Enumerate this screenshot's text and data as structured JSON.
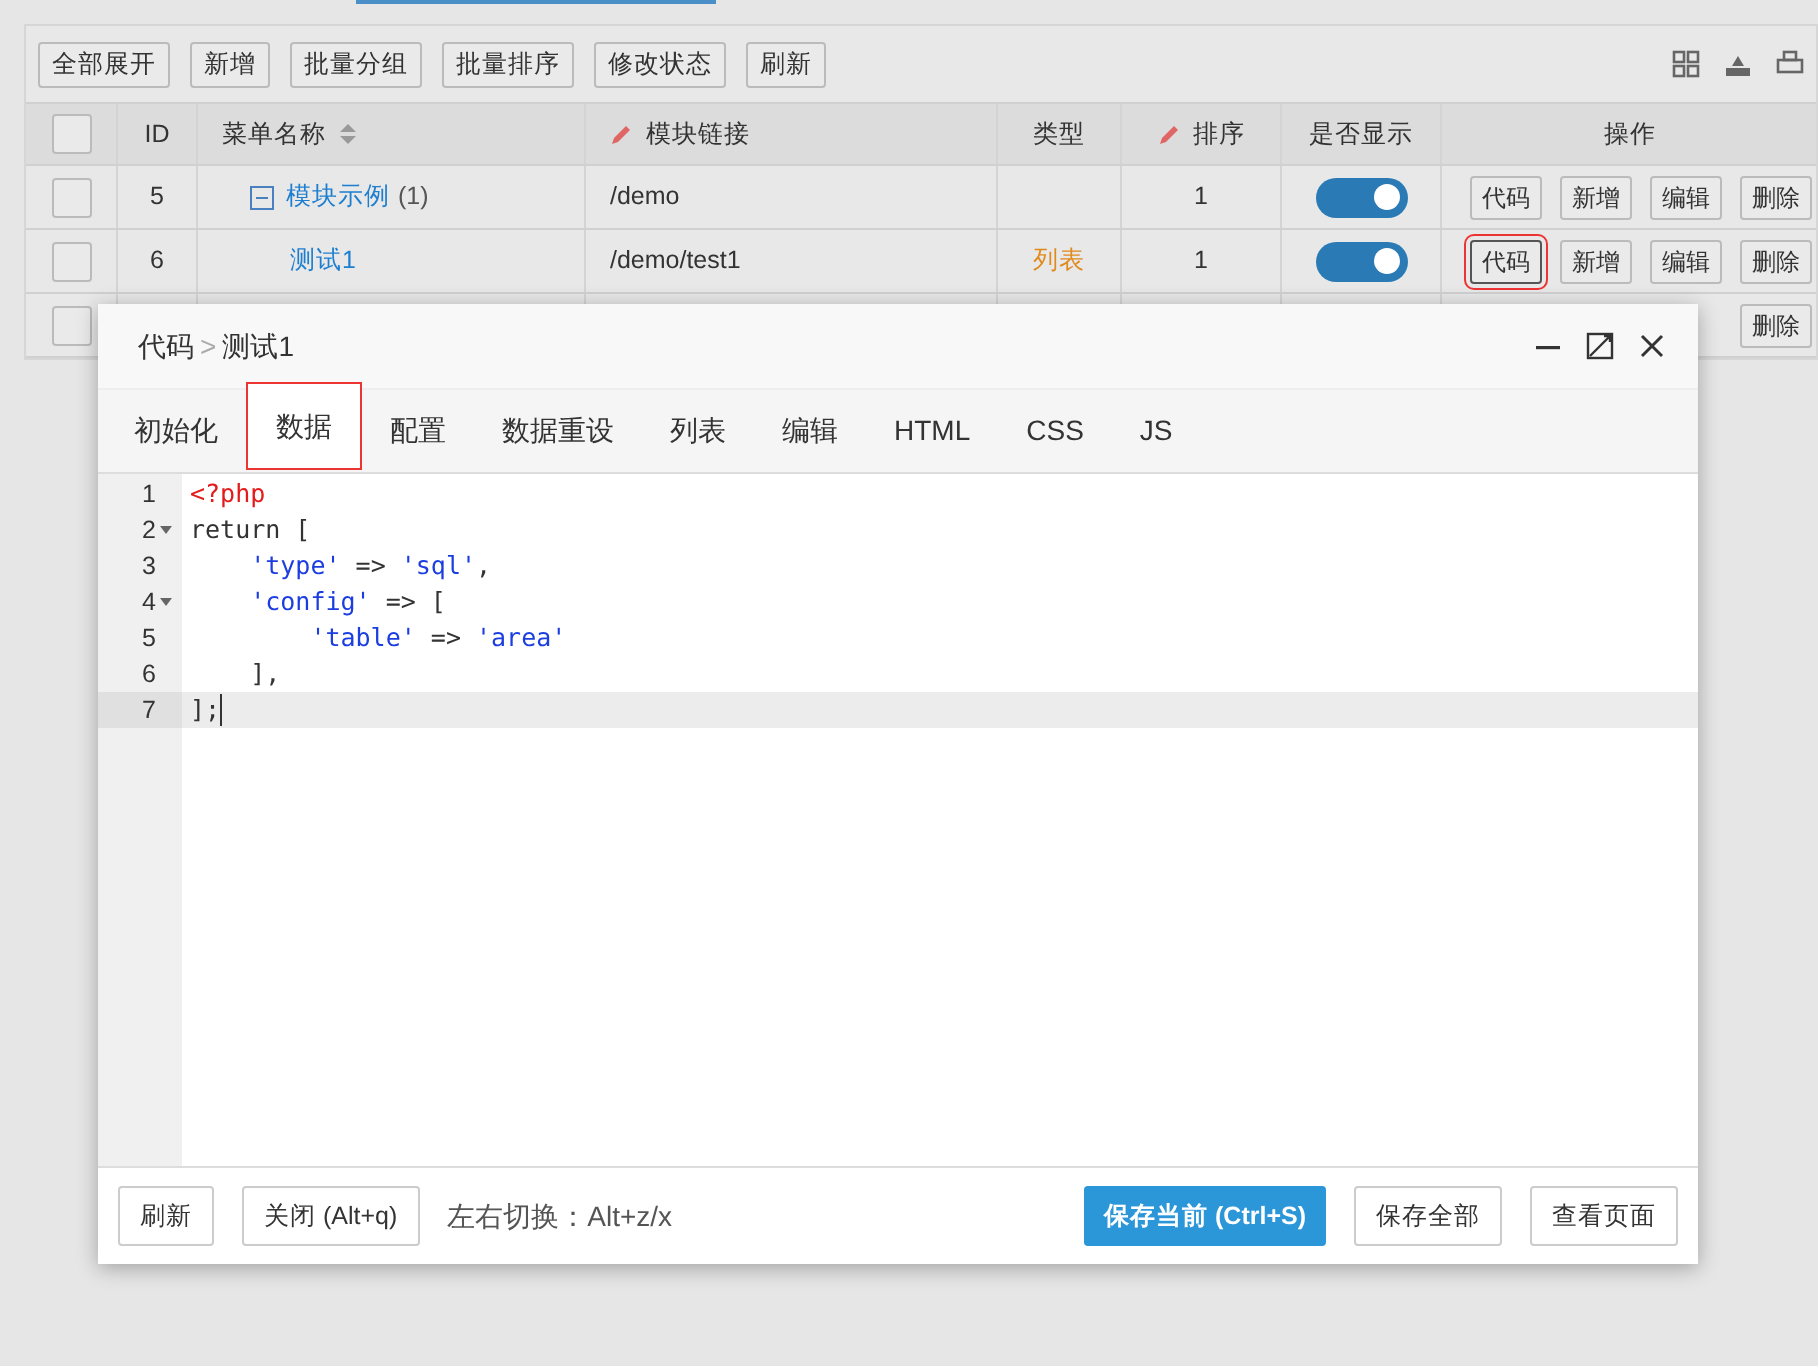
{
  "toolbar": {
    "buttons": [
      "全部展开",
      "新增",
      "批量分组",
      "批量排序",
      "修改状态",
      "刷新"
    ]
  },
  "table": {
    "select_all_checked": false,
    "columns": [
      {
        "label": "ID"
      },
      {
        "label": "菜单名称"
      },
      {
        "label": "模块链接"
      },
      {
        "label": "类型"
      },
      {
        "label": "排序"
      },
      {
        "label": "是否显示"
      },
      {
        "label": "操作"
      }
    ],
    "rows": [
      {
        "checked": false,
        "id": "5",
        "name": "模块示例",
        "count": "(1)",
        "expanded": true,
        "link": "/demo",
        "type": "",
        "sort": "1",
        "visible": true,
        "actions": [
          {
            "label": "代码",
            "selected": false
          },
          {
            "label": "新增",
            "selected": false
          },
          {
            "label": "编辑",
            "selected": false
          },
          {
            "label": "删除",
            "selected": false
          }
        ]
      },
      {
        "checked": false,
        "id": "6",
        "name": "测试1",
        "count": "",
        "link": "/demo/test1",
        "type": "列表",
        "sort": "1",
        "visible": true,
        "actions": [
          {
            "label": "代码",
            "selected": true
          },
          {
            "label": "新增",
            "selected": false
          },
          {
            "label": "编辑",
            "selected": false
          },
          {
            "label": "删除",
            "selected": false
          }
        ]
      },
      {
        "checked": false,
        "actions": [
          {
            "label": "删除",
            "selected": false
          }
        ]
      }
    ]
  },
  "modal": {
    "breadcrumb": [
      "代码",
      "测试1"
    ],
    "separator": ">",
    "tabs": [
      {
        "label": "初始化",
        "selected": false
      },
      {
        "label": "数据",
        "selected": true
      },
      {
        "label": "配置",
        "selected": false
      },
      {
        "label": "数据重设",
        "selected": false
      },
      {
        "label": "列表",
        "selected": false
      },
      {
        "label": "编辑",
        "selected": false
      },
      {
        "label": "HTML",
        "selected": false
      },
      {
        "label": "CSS",
        "selected": false
      },
      {
        "label": "JS",
        "selected": false
      }
    ],
    "code_lines": [
      {
        "number": "1",
        "foldable": false,
        "active": false,
        "tokens": [
          {
            "kind": "tag",
            "text": "<?php"
          }
        ]
      },
      {
        "number": "2",
        "foldable": true,
        "active": false,
        "tokens": [
          {
            "kind": "plain",
            "text": "return ["
          }
        ]
      },
      {
        "number": "3",
        "foldable": false,
        "active": false,
        "tokens": [
          {
            "kind": "string",
            "text": "    'type'"
          },
          {
            "kind": "plain",
            "text": " => "
          },
          {
            "kind": "string",
            "text": "'sql'"
          },
          {
            "kind": "plain",
            "text": ","
          }
        ]
      },
      {
        "number": "4",
        "foldable": true,
        "active": false,
        "tokens": [
          {
            "kind": "string",
            "text": "    'config'"
          },
          {
            "kind": "plain",
            "text": " => ["
          }
        ]
      },
      {
        "number": "5",
        "foldable": false,
        "active": false,
        "tokens": [
          {
            "kind": "string",
            "text": "        'table'"
          },
          {
            "kind": "plain",
            "text": " => "
          },
          {
            "kind": "string",
            "text": "'area'"
          }
        ]
      },
      {
        "number": "6",
        "foldable": false,
        "active": false,
        "tokens": [
          {
            "kind": "plain",
            "text": "    ],"
          }
        ]
      },
      {
        "number": "7",
        "foldable": false,
        "active": true,
        "tokens": [
          {
            "kind": "plain",
            "text": "];"
          }
        ]
      }
    ],
    "footer": {
      "left_buttons": [
        "刷新",
        "关闭 (Alt+q)"
      ],
      "hint": "左右切换：Alt+z/x",
      "primary_button": "保存当前 (Ctrl+S)",
      "right_buttons": [
        "保存全部",
        "查看页面"
      ]
    }
  }
}
